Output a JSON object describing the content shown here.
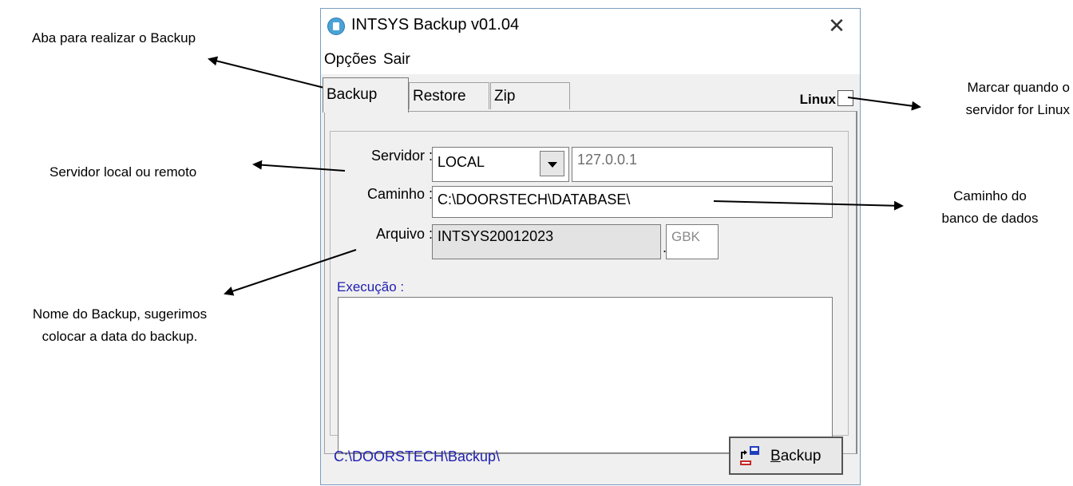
{
  "annotations": {
    "tab_callout": "Aba para realizar o Backup",
    "server_callout": "Servidor local ou remoto",
    "name_callout_line1": "Nome do Backup, sugerimos",
    "name_callout_line2": "colocar a data do backup.",
    "linux_callout_line1": "Marcar quando o",
    "linux_callout_line2": "servidor for Linux",
    "path_callout_line1": "Caminho do",
    "path_callout_line2": "banco de dados"
  },
  "window": {
    "title": "INTSYS Backup v01.04",
    "close_glyph": "✕"
  },
  "menu": {
    "opcoes": "Opções",
    "sair": "Sair"
  },
  "tabs": [
    {
      "label": "Backup",
      "active": true
    },
    {
      "label": "Restore",
      "active": false
    },
    {
      "label": "Zip",
      "active": false
    }
  ],
  "linux": {
    "label": "Linux",
    "checked": false
  },
  "form": {
    "servidor_label": "Servidor :",
    "servidor_value": "LOCAL",
    "ip_value": "127.0.0.1",
    "caminho_label": "Caminho :",
    "caminho_value": "C:\\DOORSTECH\\DATABASE\\",
    "arquivo_label": "Arquivo :",
    "arquivo_value": "INTSYS20012023",
    "ext_dot": ".",
    "ext_value": "GBK",
    "execucao_label": "Execução :"
  },
  "footer": {
    "backup_path": "C:\\DOORSTECH\\Backup\\",
    "backup_button_first": "B",
    "backup_button_rest": "ackup"
  }
}
